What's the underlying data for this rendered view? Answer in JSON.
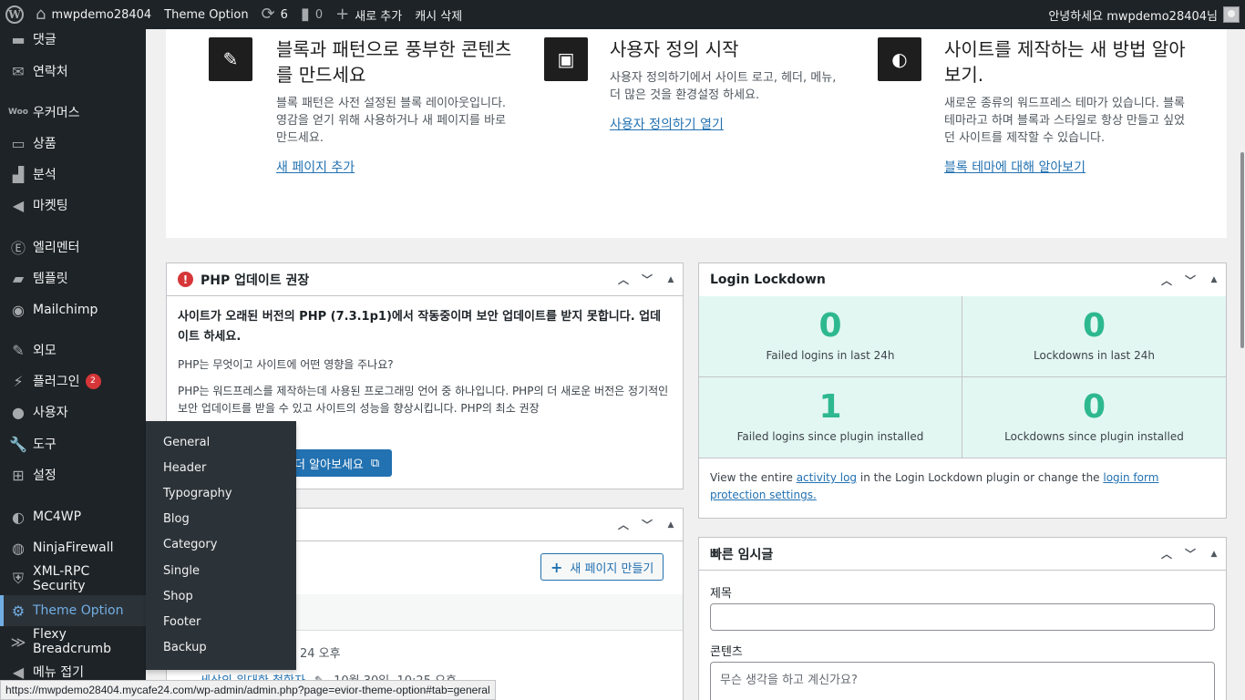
{
  "adminbar": {
    "site_name": "mwpdemo28404",
    "theme_option": "Theme Option",
    "updates_count": "6",
    "comments_count": "0",
    "new_label": "새로 추가",
    "cache_label": "캐시 삭제",
    "greeting": "안녕하세요 mwpdemo28404님"
  },
  "sidebar": {
    "items": [
      {
        "label": "댓글",
        "icon": "comment-icon"
      },
      {
        "label": "연락처",
        "icon": "mail-icon"
      },
      {
        "label": "우커머스",
        "icon": "woo-icon"
      },
      {
        "label": "상품",
        "icon": "archive-icon"
      },
      {
        "label": "분석",
        "icon": "chart-icon"
      },
      {
        "label": "마켓팅",
        "icon": "megaphone-icon"
      },
      {
        "label": "엘리멘터",
        "icon": "elementor-icon"
      },
      {
        "label": "템플릿",
        "icon": "folder-icon"
      },
      {
        "label": "Mailchimp",
        "icon": "mailchimp-icon"
      },
      {
        "label": "외모",
        "icon": "brush-icon"
      },
      {
        "label": "플러그인",
        "icon": "plugin-icon",
        "badge": "2"
      },
      {
        "label": "사용자",
        "icon": "user-icon"
      },
      {
        "label": "도구",
        "icon": "wrench-icon"
      },
      {
        "label": "설정",
        "icon": "settings-icon"
      },
      {
        "label": "MC4WP",
        "icon": "mc4wp-icon"
      },
      {
        "label": "NinjaFirewall",
        "icon": "ninja-icon"
      },
      {
        "label": "XML-RPC Security",
        "icon": "shield-icon"
      },
      {
        "label": "Theme Option",
        "icon": "gear-icon"
      },
      {
        "label": "Flexy Breadcrumb",
        "icon": "breadcrumb-icon"
      },
      {
        "label": "메뉴 접기",
        "icon": "collapse-icon"
      }
    ]
  },
  "flyout": {
    "items": [
      "General",
      "Header",
      "Typography",
      "Blog",
      "Category",
      "Single",
      "Shop",
      "Footer",
      "Backup"
    ]
  },
  "welcome": {
    "col1": {
      "title": "블록과 패턴으로 풍부한 콘텐츠를 만드세요",
      "desc": "블록 패턴은 사전 설정된 블록 레이아웃입니다. 영감을 얻기 위해 사용하거나 새 페이지를 바로 만드세요.",
      "link": "새 페이지 추가"
    },
    "col2": {
      "title": "사용자 정의 시작",
      "desc": "사용자 정의하기에서 사이트 로고, 헤더, 메뉴, 더 많은 것을 환경설정 하세요.",
      "link": "사용자 정의하기 열기"
    },
    "col3": {
      "title": "사이트를 제작하는 새 방법 알아보기.",
      "desc": "새로운 종류의 워드프레스 테마가 있습니다. 블록 테마라고 하며 블록과 스타일로 항상 만들고 싶었던 사이트를 제작할 수 있습니다.",
      "link": "블록 테마에 대해 알아보기"
    }
  },
  "php": {
    "title": "PHP 업데이트 권장",
    "strong": "사이트가 오래된 버전의 PHP (7.3.1p1)에서 작동중이며 보안 업데이트를 받지 못합니다. 업데이트 하세요.",
    "q": "PHP는 무엇이고 사이트에 어떤 영향을 주나요?",
    "p": "PHP는 워드프레스를 제작하는데 사용된 프로그래밍 언어 중 하나입니다. PHP의 더 새로운 버전은 정기적인 보안 업데이트를 받을 수 있고 사이트의 성능을 향상시킵니다. PHP의 최소 권장",
    "button": "더 알아보세요"
  },
  "activity": {
    "new_page_button": "새 페이지 만들기",
    "time1": "24 오후",
    "post_title": "세상의 위대한 철학자",
    "post_time": "10월 30일, 10:25 오후"
  },
  "lockdown": {
    "title": "Login Lockdown",
    "stats": [
      {
        "value": "0",
        "label": "Failed logins in last 24h"
      },
      {
        "value": "0",
        "label": "Lockdowns in last 24h"
      },
      {
        "value": "1",
        "label": "Failed logins since plugin installed"
      },
      {
        "value": "0",
        "label": "Lockdowns since plugin installed"
      }
    ],
    "foot_pre": "View the entire ",
    "foot_link1": "activity log",
    "foot_mid": " in the Login Lockdown plugin or change the ",
    "foot_link2": "login form protection settings."
  },
  "quickdraft": {
    "title": "빠른 임시글",
    "title_label": "제목",
    "content_label": "콘텐츠",
    "content_placeholder": "무슨 생각을 하고 계신가요?"
  },
  "statusbar": {
    "url": "https://mwpdemo28404.mycafe24.com/wp-admin/admin.php?page=evior-theme-option#tab=general"
  }
}
